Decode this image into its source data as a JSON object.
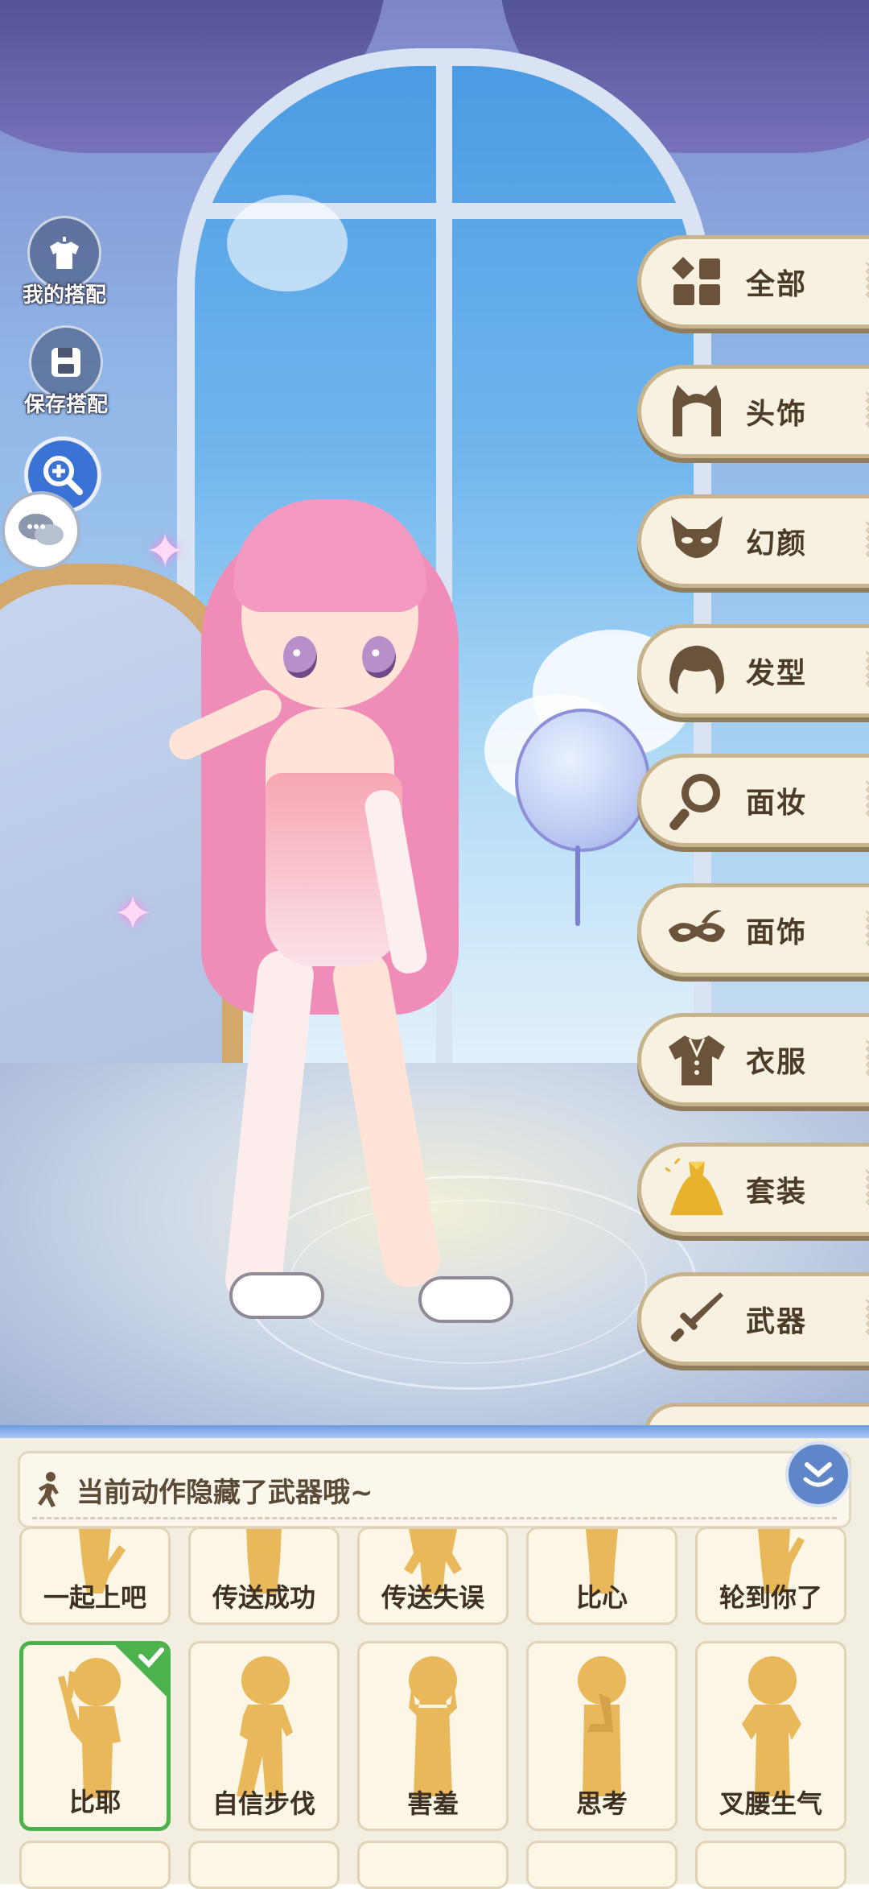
{
  "left_controls": {
    "my_outfits": "我的搭配",
    "save_outfit": "保存搭配",
    "zoom_icon": "zoom-in-icon",
    "chat_icon": "chat-bubbles-icon"
  },
  "categories": [
    {
      "label": "全部",
      "icon": "grid-icon"
    },
    {
      "label": "头饰",
      "icon": "cat-ears-icon"
    },
    {
      "label": "幻颜",
      "icon": "fox-mask-icon"
    },
    {
      "label": "发型",
      "icon": "hair-icon"
    },
    {
      "label": "面妆",
      "icon": "mirror-icon"
    },
    {
      "label": "面饰",
      "icon": "eye-mask-icon"
    },
    {
      "label": "衣服",
      "icon": "shirt-icon"
    },
    {
      "label": "套装",
      "icon": "golden-dress-icon"
    },
    {
      "label": "武器",
      "icon": "sword-icon"
    }
  ],
  "panel": {
    "notice": "当前动作隐藏了武器哦~",
    "actions_row1": [
      "一起上吧",
      "传送成功",
      "传送失误",
      "比心",
      "轮到你了"
    ],
    "actions_row2": [
      "比耶",
      "自信步伐",
      "害羞",
      "思考",
      "叉腰生气"
    ],
    "selected": "比耶"
  },
  "colors": {
    "accent_gold": "#E8B85A",
    "selected_green": "#4CB34C",
    "panel_bg": "#F3EEE2",
    "category_text": "#4B3B27"
  }
}
